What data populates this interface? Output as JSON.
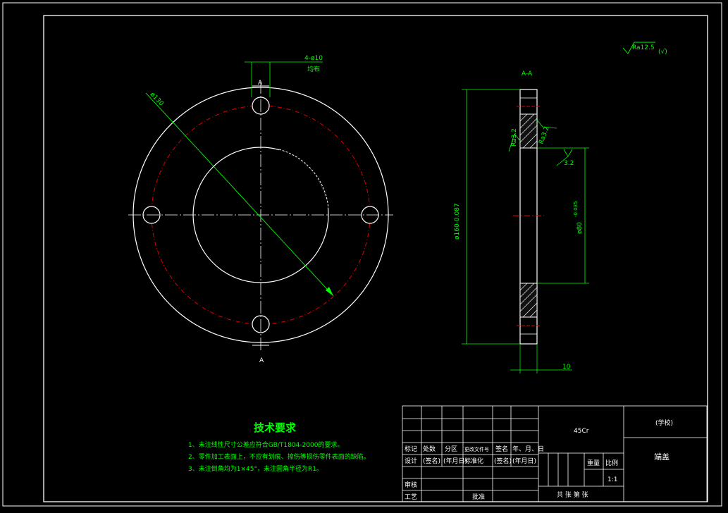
{
  "drawing": {
    "dim_holes": "4-ø10",
    "dim_holes_note": "均布",
    "dim_pcd": "ø130",
    "section_mark": "A",
    "section_title": "A-A",
    "dim_outer": "ø160-0.087",
    "dim_bore": "ø80",
    "dim_bore_tol": "-0.035",
    "dim_thickness": "10",
    "roughness_general": "Ra12.5",
    "roughness_general_note": "(√)",
    "roughness_1": "Ra3.2",
    "roughness_2": "Ra3.2",
    "roughness_3": "3.2"
  },
  "tech_req": {
    "title": "技术要求",
    "items": [
      "1、未注线性尺寸公差应符合GB/T1804-2000的要求。",
      "2、零件加工表面上，不应有划痕、擦伤等损伤零件表面的缺陷。",
      "3、未注倒角均为1×45°，未注圆角半径为R1。"
    ]
  },
  "title_block": {
    "material": "45Cr",
    "school": "(学校)",
    "part_name": "端盖",
    "h_mark": "标记",
    "h_count": "处数",
    "h_zone": "分区",
    "h_doc": "更改文件号",
    "h_sign": "签名",
    "h_date": "年、月、日",
    "design": "设计",
    "sign_name": "(签名)",
    "sign_date": "(年月日)",
    "standard": "标准化",
    "sign_name2": "(签名)",
    "sign_date2": "(年月日)",
    "weight": "重量",
    "scale": "比例",
    "scale_val": "1:1",
    "review": "审核",
    "process": "工艺",
    "approve": "批准",
    "sheets": "共  张  第  张"
  }
}
